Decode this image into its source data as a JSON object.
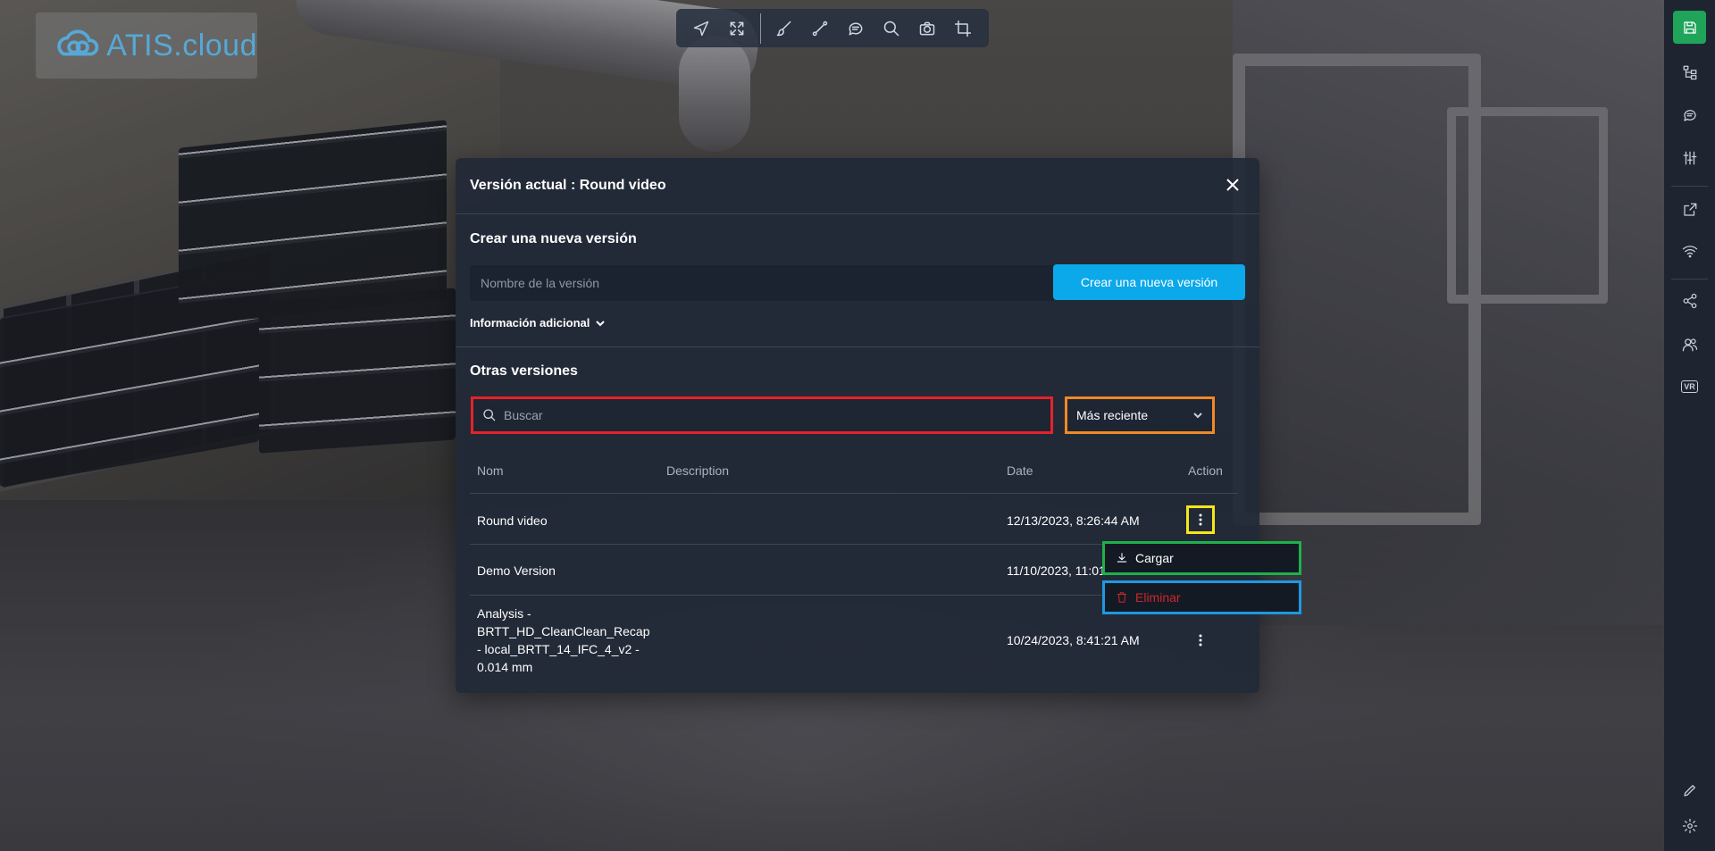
{
  "app": {
    "logo_text": "ATIS.cloud"
  },
  "toolbar": {
    "tools": [
      {
        "icon": "navigate-icon"
      },
      {
        "icon": "fullscreen-icon"
      },
      {
        "icon": "brush-icon"
      },
      {
        "icon": "measure-icon"
      },
      {
        "icon": "comment-icon"
      },
      {
        "icon": "search-icon"
      },
      {
        "icon": "camera-icon"
      },
      {
        "icon": "crop-icon"
      }
    ]
  },
  "sidebar": {
    "items": [
      {
        "icon": "save-icon",
        "active": true
      },
      {
        "icon": "tree-icon"
      },
      {
        "icon": "chat-icon"
      },
      {
        "icon": "sliders-icon"
      },
      {
        "icon": "external-link-icon"
      },
      {
        "icon": "wifi-icon"
      },
      {
        "icon": "share-icon"
      },
      {
        "icon": "users-icon"
      },
      {
        "icon": "vr-icon"
      },
      {
        "icon": "pencil-icon"
      },
      {
        "icon": "settings-icon"
      }
    ],
    "vr_label": "VR"
  },
  "dialog": {
    "title": "Versión actual : Round video",
    "create_section_title": "Crear una nueva versión",
    "name_placeholder": "Nombre de la versión",
    "create_button": "Crear una nueva versión",
    "additional_info": "Información adicional",
    "other_versions_title": "Otras versiones",
    "search_placeholder": "Buscar",
    "sort_selected": "Más reciente",
    "table": {
      "headers": {
        "name": "Nom",
        "description": "Description",
        "date": "Date",
        "action": "Action"
      },
      "rows": [
        {
          "name": "Round video",
          "description": "",
          "date": "12/13/2023, 8:26:44 AM"
        },
        {
          "name": "Demo Version",
          "description": "",
          "date": "11/10/2023, 11:01"
        },
        {
          "name": "Analysis - BRTT_HD_CleanClean_Recap - local_BRTT_14_IFC_4_v2 - 0.014 mm",
          "description": "",
          "date": "10/24/2023, 8:41:21 AM"
        }
      ]
    },
    "row_menu": {
      "load": "Cargar",
      "delete": "Eliminar"
    }
  },
  "colors": {
    "accent": "#0ba8ea",
    "active_sidebar": "#1fa45a",
    "danger": "#c8282c",
    "highlight_search": "#e5222a",
    "highlight_sort": "#f08a24",
    "highlight_action": "#f5e51c",
    "highlight_load": "#1fb04a",
    "highlight_delete": "#1f98e0"
  }
}
